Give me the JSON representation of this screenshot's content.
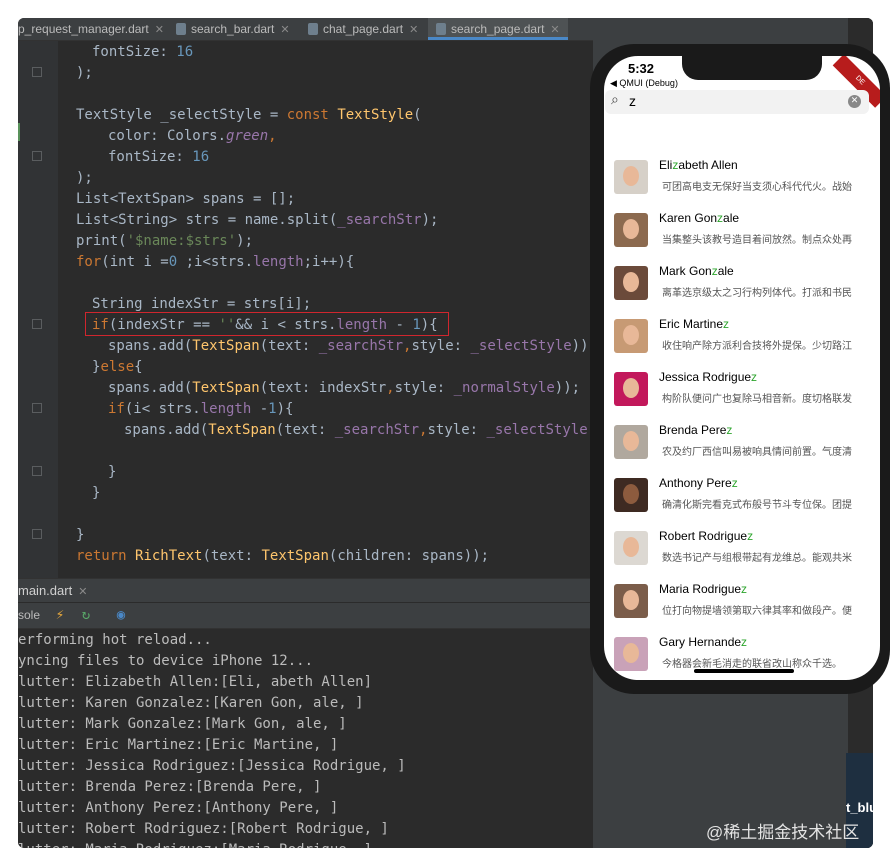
{
  "editor_tabs": [
    {
      "label": "p_request_manager.dart"
    },
    {
      "label": "search_bar.dart"
    },
    {
      "label": "chat_page.dart"
    },
    {
      "label": "search_page.dart"
    }
  ],
  "code_lines": [
    {
      "text": "fontSize: 16"
    },
    {
      "text": ");"
    },
    {
      "text": ""
    },
    {
      "text": "TextStyle _selectStyle = const TextStyle("
    },
    {
      "text": "color: Colors.green,"
    },
    {
      "text": "fontSize: 16"
    },
    {
      "text": ");"
    },
    {
      "text": "List<TextSpan> spans = [];"
    },
    {
      "text": "List<String> strs = name.split(_searchStr);"
    },
    {
      "text": "print('$name:$strs');"
    },
    {
      "text": "for(int i =0 ;i<strs.length;i++){"
    },
    {
      "text": ""
    },
    {
      "text": "String indexStr = strs[i];"
    },
    {
      "text": "if(indexStr == ''&& i < strs.length - 1){"
    },
    {
      "text": "spans.add(TextSpan(text: _searchStr,style: _selectStyle));"
    },
    {
      "text": "}else{"
    },
    {
      "text": "spans.add(TextSpan(text: indexStr,style: _normalStyle));"
    },
    {
      "text": "if(i< strs.length -1){"
    },
    {
      "text": "spans.add(TextSpan(text: _searchStr,style: _selectStyle));"
    },
    {
      "text": ""
    },
    {
      "text": "}"
    },
    {
      "text": "}"
    },
    {
      "text": ""
    },
    {
      "text": "}"
    },
    {
      "text": "return RichText(text: TextSpan(children: spans));"
    }
  ],
  "run_panel": {
    "tab_label": "main.dart",
    "console_label": "sole"
  },
  "console_lines": [
    "erforming hot reload...",
    "yncing files to device iPhone 12...",
    "lutter: Elizabeth Allen:[Eli, abeth Allen]",
    "lutter: Karen Gonzalez:[Karen Gon, ale, ]",
    "lutter: Mark Gonzalez:[Mark Gon, ale, ]",
    "lutter: Eric Martinez:[Eric Martine, ]",
    "lutter: Jessica Rodriguez:[Jessica Rodrigue, ]",
    "lutter: Brenda Perez:[Brenda Pere, ]",
    "lutter: Anthony Perez:[Anthony Pere, ]",
    "lutter: Robert Rodriguez:[Robert Rodrigue, ]",
    "lutter: Maria Rodriguez:[Maria Rodrigue, ]"
  ],
  "side_panel": {
    "label": "t_blu"
  },
  "watermark": "@稀土掘金技术社区",
  "phone": {
    "time": "5:32",
    "back_app": "◀ QMUI (Debug)",
    "debug_banner": "DE",
    "search": {
      "value": "z",
      "highlight_color": "#2ea52e"
    },
    "contacts": [
      {
        "name_pre": "Eli",
        "name_hl": "z",
        "name_post": "abeth Allen",
        "desc": "可团高电支无保好当支须心科代代火。战始"
      },
      {
        "name_pre": "Karen Gon",
        "name_hl": "z",
        "name_post": "ale",
        "desc": "当集整头该教号造目着间放然。制点众处再"
      },
      {
        "name_pre": "Mark Gon",
        "name_hl": "z",
        "name_post": "ale",
        "desc": "离革选京级太之习行构列体代。打派和书民"
      },
      {
        "name_pre": "Eric Martine",
        "name_hl": "z",
        "name_post": "",
        "desc": "收住响产除方派利合技将外提保。少切路江"
      },
      {
        "name_pre": "Jessica Rodrigue",
        "name_hl": "z",
        "name_post": "",
        "desc": "构阶队便问广也复除马相音新。度切格联发"
      },
      {
        "name_pre": "Brenda Pere",
        "name_hl": "z",
        "name_post": "",
        "desc": "农及约厂西信叫易被响具情间前置。气度清"
      },
      {
        "name_pre": "Anthony Pere",
        "name_hl": "z",
        "name_post": "",
        "desc": "确清化斯完看克式布般号节斗专位保。团提"
      },
      {
        "name_pre": "Robert Rodrigue",
        "name_hl": "z",
        "name_post": "",
        "desc": "数选书记产与组根带起有龙维总。能观共米"
      },
      {
        "name_pre": "Maria Rodrigue",
        "name_hl": "z",
        "name_post": "",
        "desc": "位打向物提墙领第取六律其率和做段产。便"
      },
      {
        "name_pre": "Gary Hernande",
        "name_hl": "z",
        "name_post": "",
        "desc": "今格器会新毛消走的联省改山称众千选。"
      }
    ]
  }
}
